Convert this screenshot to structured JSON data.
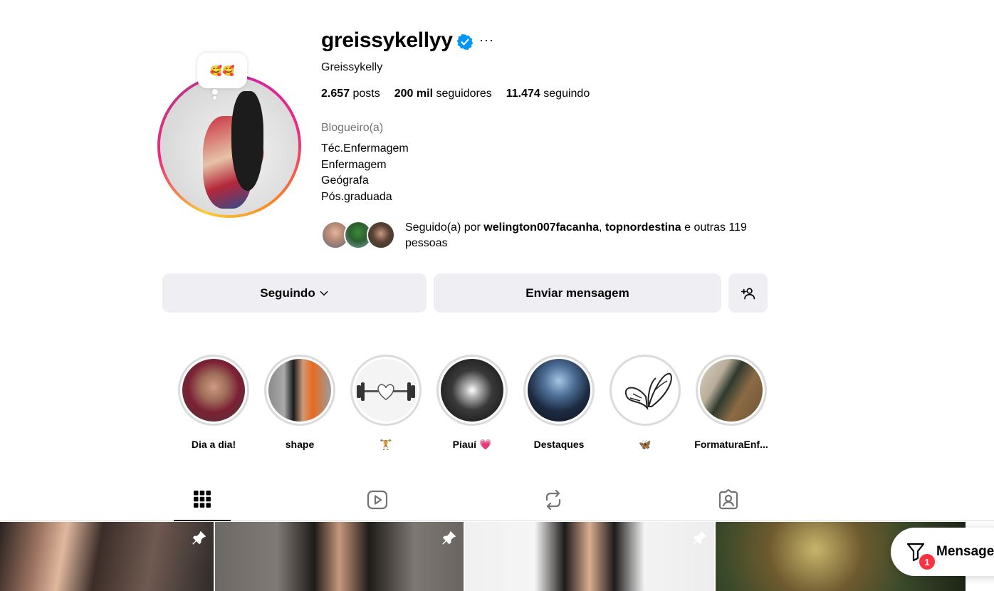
{
  "profile": {
    "username": "greissykellyy",
    "full_name": "Greissykelly",
    "note": "🥰🥰",
    "stats": [
      {
        "value": "2.657",
        "label": "posts"
      },
      {
        "value": "200 mil",
        "label": "seguidores"
      },
      {
        "value": "11.474",
        "label": "seguindo"
      }
    ],
    "category": "Blogueiro(a)",
    "bio": [
      "Téc.Enfermagem",
      "Enfermagem",
      "Geógrafa",
      "Pós.graduada"
    ],
    "followed_by": {
      "prefix": "Seguido(a) por",
      "user1": "welington007facanha",
      "sep": ",",
      "user2": "topnordestina",
      "suffix": "e outras 119 pessoas"
    }
  },
  "buttons": {
    "following": "Seguindo",
    "message": "Enviar mensagem"
  },
  "highlights": [
    {
      "label": "Dia a dia!"
    },
    {
      "label": "shape"
    },
    {
      "label": "🏋️"
    },
    {
      "label": "Piauí 💗"
    },
    {
      "label": "Destaques"
    },
    {
      "label": "🦋"
    },
    {
      "label": "FormaturaEnf..."
    }
  ],
  "tabs": [
    "posts",
    "reels",
    "reposts",
    "tagged"
  ],
  "messages_fab": {
    "label": "Mensagens",
    "badge": "1"
  },
  "colors": {
    "verified": "#0095f6",
    "button_bg": "#efeff3",
    "badge": "#ff3040"
  }
}
